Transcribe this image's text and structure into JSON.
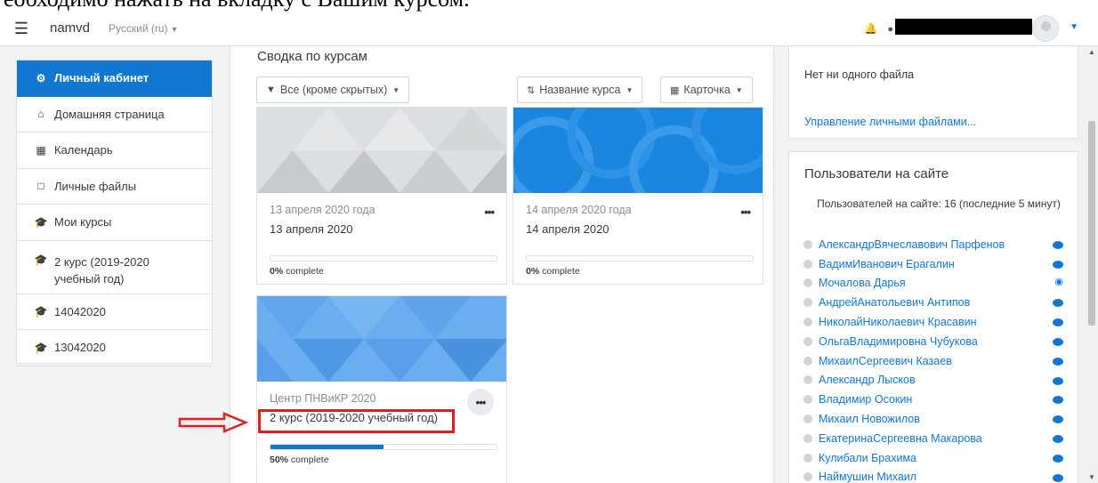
{
  "doc_caption": "еобходимо нажать на вкладку с Вашим курсом.",
  "navbar": {
    "menu_icon": "hamburger-icon",
    "site_name": "namvd",
    "language": "Русский (ru)"
  },
  "drawer": {
    "items": [
      {
        "label": "Личный кабинет",
        "icon": "dashboard-icon"
      },
      {
        "label": "Домашняя страница",
        "icon": "home-icon"
      },
      {
        "label": "Календарь",
        "icon": "calendar-icon"
      },
      {
        "label": "Личные файлы",
        "icon": "file-icon"
      },
      {
        "label": "Мои курсы",
        "icon": "graduation-cap-icon"
      },
      {
        "label": "2 курс (2019-2020 учебный год)",
        "icon": "graduation-cap-icon"
      },
      {
        "label": "14042020",
        "icon": "graduation-cap-icon"
      },
      {
        "label": "13042020",
        "icon": "graduation-cap-icon"
      }
    ]
  },
  "overview": {
    "title": "Сводка по курсам",
    "filter_label": "Все (кроме скрытых)",
    "sort_label": "Название курса",
    "view_label": "Карточка",
    "cards": [
      {
        "category": "13 апреля 2020 года",
        "name": "13 апреля 2020",
        "percent": "0%",
        "complete_label": " complete",
        "progress": 0
      },
      {
        "category": "14 апреля 2020 года",
        "name": "14 апреля 2020",
        "percent": "0%",
        "complete_label": " complete",
        "progress": 0
      },
      {
        "category": "Центр ПНВиКР 2020",
        "name": "2 курс (2019-2020 учебный год)",
        "percent": "50%",
        "complete_label": " complete",
        "progress": 0.5
      }
    ]
  },
  "files_block": {
    "empty_text": "Нет ни одного файла",
    "manage_link": "Управление личными файлами..."
  },
  "online_users": {
    "title": "Пользователи на сайте",
    "count_text": "Пользователей на сайте: 16 (последние 5 минут)",
    "users": [
      {
        "name": "АлександрВячеславович Парфенов",
        "action": "message-icon"
      },
      {
        "name": "ВадимИванович Ерагалин",
        "action": "message-icon"
      },
      {
        "name": "Мочалова Дарья",
        "action": "eye-icon"
      },
      {
        "name": "АндрейАнатольевич Антипов",
        "action": "message-icon"
      },
      {
        "name": "НиколайНиколаевич Красавин",
        "action": "message-icon"
      },
      {
        "name": "ОльгаВладимировна Чубукова",
        "action": "message-icon"
      },
      {
        "name": "МихаилСергеевич Казаев",
        "action": "message-icon"
      },
      {
        "name": "Александр Лысков",
        "action": "message-icon"
      },
      {
        "name": "Владимир Осокин",
        "action": "message-icon"
      },
      {
        "name": "Михаил Новожилов",
        "action": "message-icon"
      },
      {
        "name": "ЕкатеринаСергеевна Макарова",
        "action": "message-icon"
      },
      {
        "name": "Кулибали Брахима",
        "action": "message-icon"
      },
      {
        "name": "Наймушин Михаил",
        "action": "message-icon"
      }
    ]
  },
  "colors": {
    "primary": "#1177d1",
    "annotation_red": "#e02020"
  }
}
